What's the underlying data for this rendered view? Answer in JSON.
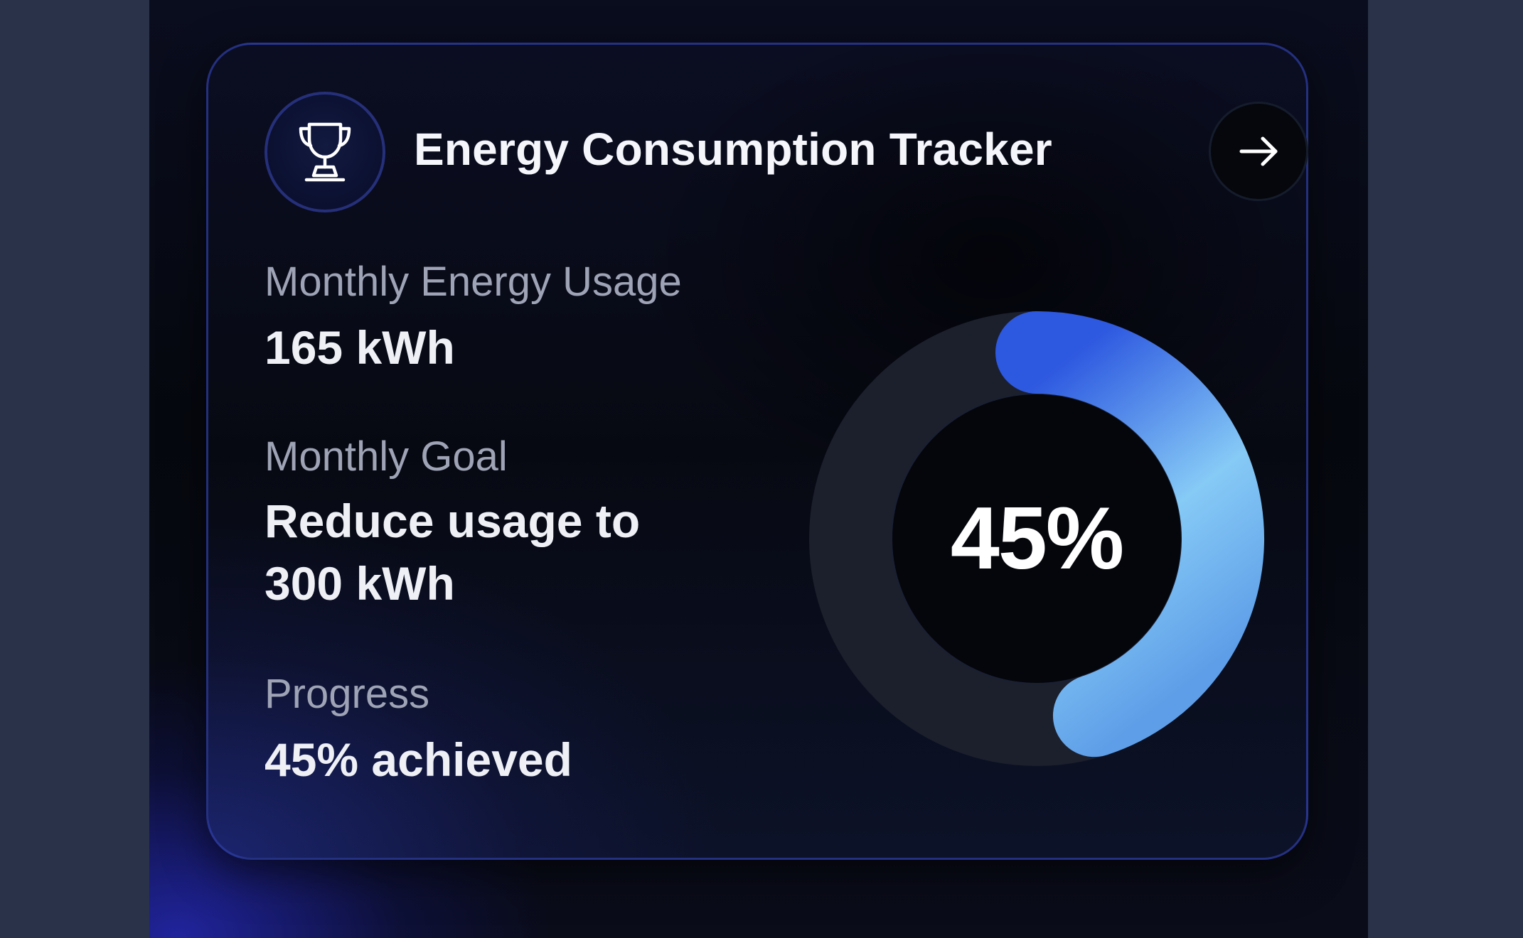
{
  "card": {
    "title": "Energy Consumption Tracker",
    "badge_icon": "trophy-icon",
    "action_icon": "arrow-right-icon"
  },
  "stats": {
    "usage_label": "Monthly Energy Usage",
    "usage_value": "165 kWh",
    "goal_label": "Monthly Goal",
    "goal_value": "Reduce usage to 300 kWh",
    "progress_label": "Progress",
    "progress_value": "45% achieved"
  },
  "ring": {
    "progress_fraction": 0.45,
    "center_label": "45%",
    "track_color": "#1c202d",
    "gradient_colors": [
      "#2d58e0",
      "#86caf6",
      "#5e9ee8"
    ]
  }
}
